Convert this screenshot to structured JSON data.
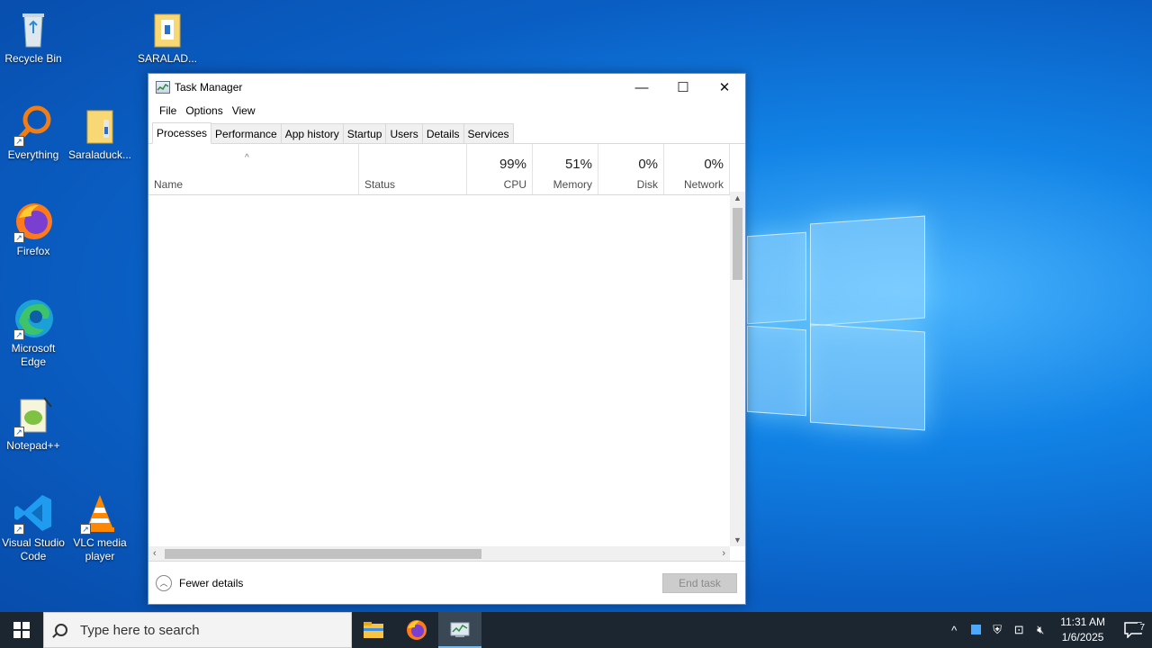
{
  "desktop": {
    "icons": [
      {
        "label": "Recycle Bin"
      },
      {
        "label": "SARALAD..."
      },
      {
        "label": "Everything"
      },
      {
        "label": "Saraladuck..."
      },
      {
        "label": "Firefox"
      },
      {
        "label": "Microsoft Edge"
      },
      {
        "label": "Notepad++"
      },
      {
        "label": "Visual Studio Code"
      },
      {
        "label": "VLC media player"
      }
    ]
  },
  "window": {
    "title": "Task Manager",
    "controls": {
      "minimize": "—",
      "maximize": "☐",
      "close": "✕"
    },
    "menu": [
      "File",
      "Options",
      "View"
    ],
    "tabs": [
      "Processes",
      "Performance",
      "App history",
      "Startup",
      "Users",
      "Details",
      "Services"
    ],
    "active_tab": "Processes",
    "columns": {
      "name": "Name",
      "status": "Status",
      "cpu": {
        "label": "CPU",
        "value": "99%"
      },
      "memory": {
        "label": "Memory",
        "value": "51%"
      },
      "disk": {
        "label": "Disk",
        "value": "0%"
      },
      "network": {
        "label": "Network",
        "value": "0%"
      }
    },
    "footer": {
      "fewer_details": "Fewer details",
      "end_task": "End task"
    }
  },
  "taskbar": {
    "search_placeholder": "Type here to search",
    "clock": {
      "time": "11:31 AM",
      "date": "1/6/2025"
    },
    "notification_count": "7"
  }
}
